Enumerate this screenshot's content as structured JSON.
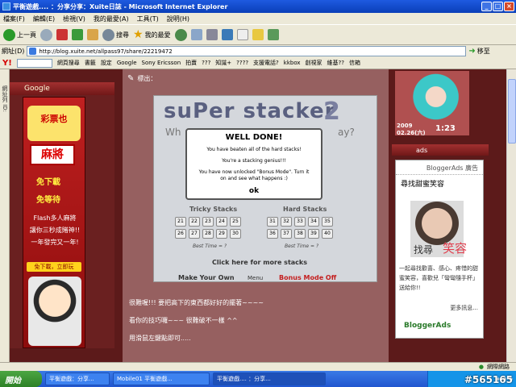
{
  "window": {
    "title": "平衡遊戲.... ：分享分享：Xuite日誌 - Microsoft Internet Explorer"
  },
  "menu": [
    "檔案(F)",
    "編輯(E)",
    "檢視(V)",
    "我的最愛(A)",
    "工具(T)",
    "說明(H)"
  ],
  "toolbar": {
    "back": "上一頁",
    "search": "搜尋",
    "favorites": "我的最愛"
  },
  "address": {
    "label": "網址(D)",
    "url": "http://blog.xuite.net/allpass97/share/22219472",
    "go": "移至"
  },
  "ybar": {
    "search_btn": "網頁搜尋",
    "items": [
      "書籤",
      "設定",
      "Google",
      "Sony Ericsson",
      "拍賣",
      "???",
      "知識+",
      "????",
      "支援電話?",
      "kkbox",
      "創視家",
      "維基??",
      "信箱"
    ]
  },
  "sidebar_left_text": "網址列 ID:",
  "google_col": {
    "header": "Google",
    "ad_title": "彩票也",
    "ad_game": "麻將",
    "offer1": "免下載",
    "offer2": "免等待",
    "lines": [
      "Flash多人麻將",
      "讓你三秒成賭神!!",
      "一年發完又一年!"
    ],
    "cta": "免下載，立即玩"
  },
  "post": {
    "title": "標出：",
    "game": {
      "title": "suPer stacker",
      "title_num": "2",
      "subtitle_left": "Wh",
      "subtitle_right": "ay?",
      "tricky_label": "Tricky Stacks",
      "hard_label": "Hard Stacks",
      "tricky_nums": [
        "21",
        "22",
        "23",
        "24",
        "25",
        "26",
        "27",
        "28",
        "29",
        "30"
      ],
      "hard_nums": [
        "31",
        "32",
        "33",
        "34",
        "35",
        "36",
        "37",
        "38",
        "39",
        "40"
      ],
      "best_time": "Best Time = ?",
      "more": "Click here for more stacks",
      "make": "Make Your Own",
      "menu": "Menu",
      "bonus": "Bonus Mode Off",
      "dialog": {
        "heading": "WELL DONE!",
        "line1": "You have beaten all of the hard stacks!",
        "line2": "You're a stacking genius!!!",
        "line3": "You have now unlocked \"Bonus Mode\". Turn it on and see what happens :)",
        "ok": "ok"
      }
    },
    "lines": [
      "很難喔!!! 要把高下的東西都好好的擺著~~~~",
      "看你的技巧囉~~~ 很難破不一樣 ^^",
      "用滑鼠左鍵點即可....."
    ]
  },
  "right_col": {
    "time_text": "2009\n02.26(六)",
    "clock": "1:23",
    "ads_header": "ads",
    "ad_box_header": "BloggerAds 廣告",
    "ad_title": "尋找甜蜜笑容",
    "ad_photo_word1": "找尋",
    "ad_photo_word2": "笑容",
    "ad_desc": "一起尋找歡喜、感心、疼惜的甜蜜笑容，喜歡兒「彎彎隨手杯」送給你!!",
    "more": "更多訊息...",
    "logo": "BloggerAds"
  },
  "status": {
    "zone": "網際網路"
  },
  "taskbar": {
    "start": "開始",
    "tasks": [
      "平衡遊戲：分享...",
      "Mobile01 平衡遊戲...",
      "平衡遊戲.... ：分享..."
    ]
  },
  "watermark": "#565165"
}
